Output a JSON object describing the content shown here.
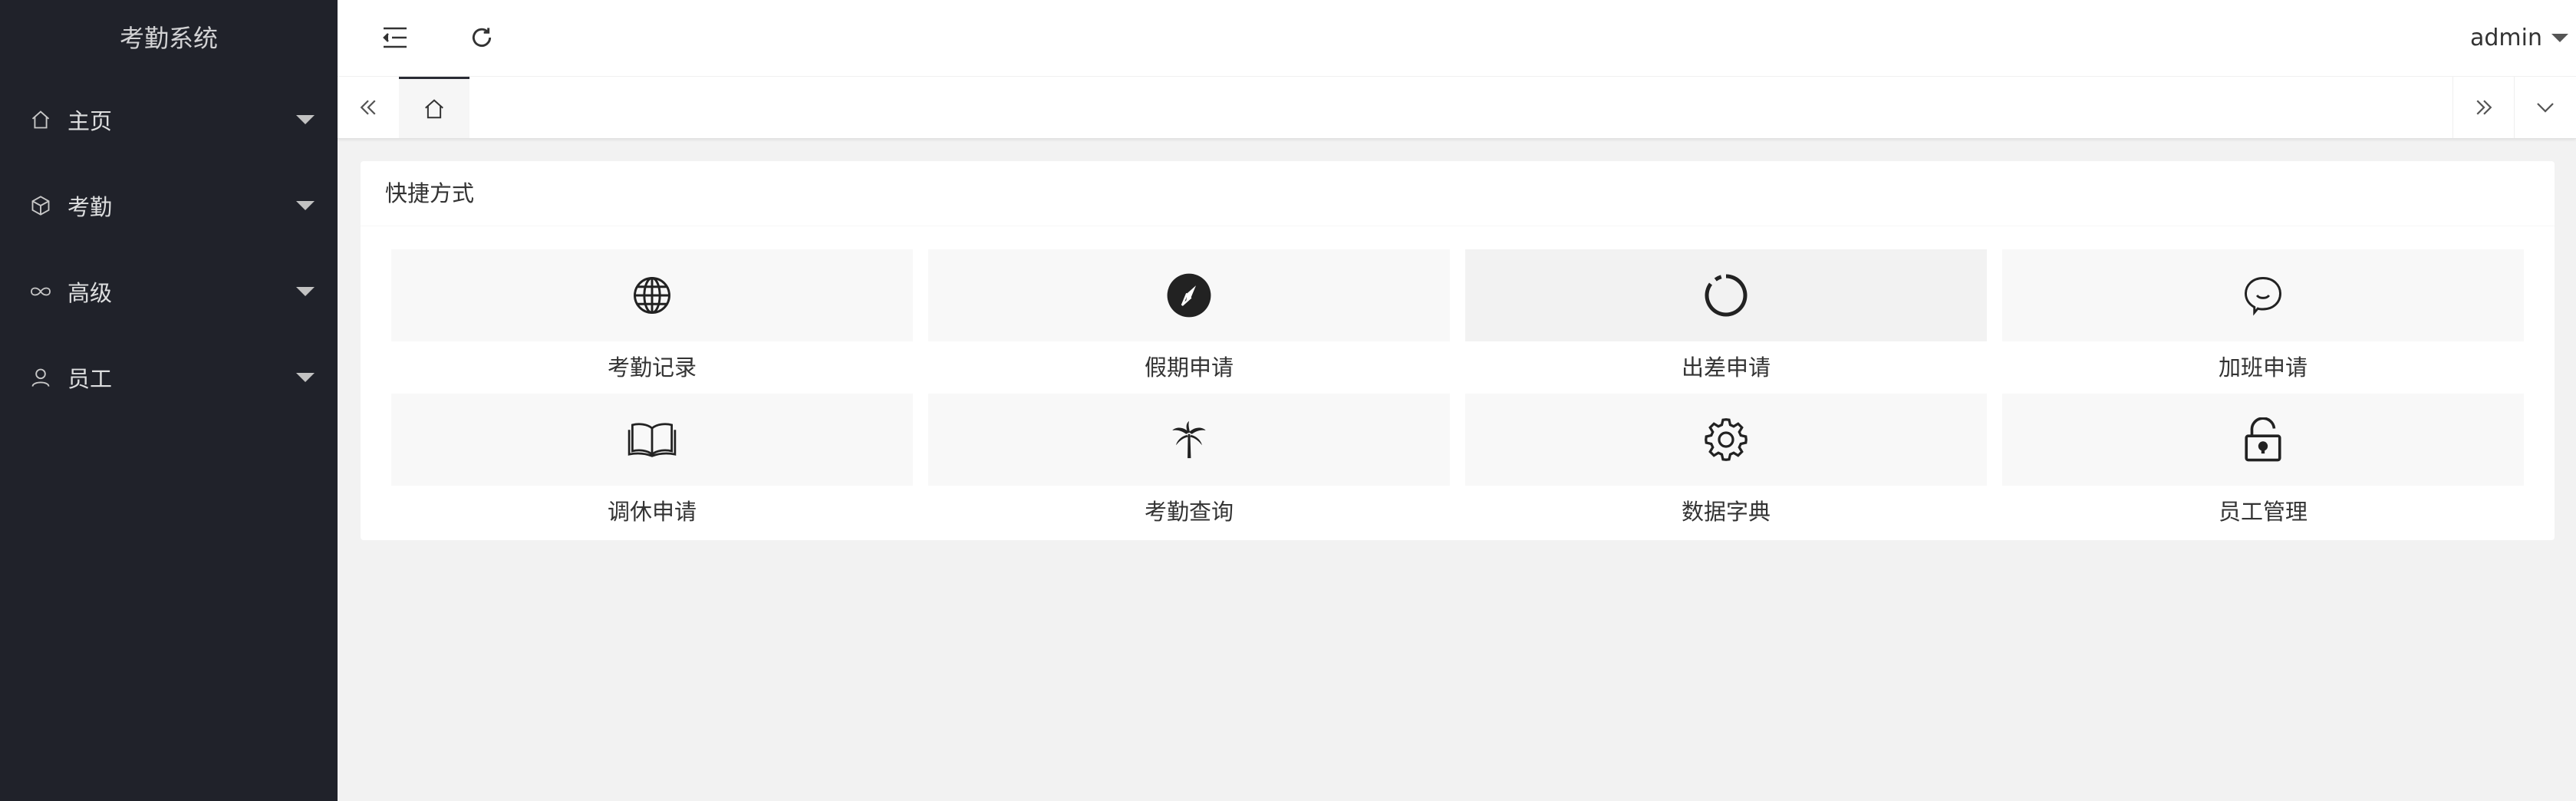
{
  "app": {
    "title": "考勤系统"
  },
  "sidebar": {
    "items": [
      {
        "label": "主页",
        "icon": "home-icon"
      },
      {
        "label": "考勤",
        "icon": "cube-icon"
      },
      {
        "label": "高级",
        "icon": "infinity-icon"
      },
      {
        "label": "员工",
        "icon": "user-icon"
      }
    ]
  },
  "header": {
    "user": "admin"
  },
  "tabs": {
    "home_icon": "home-icon"
  },
  "shortcuts": {
    "title": "快捷方式",
    "items": [
      {
        "label": "考勤记录",
        "icon": "globe-icon"
      },
      {
        "label": "假期申请",
        "icon": "compass-icon"
      },
      {
        "label": "出差申请",
        "icon": "loading-ring-icon"
      },
      {
        "label": "加班申请",
        "icon": "chat-bubble-icon"
      },
      {
        "label": "调休申请",
        "icon": "open-book-icon"
      },
      {
        "label": "考勤查询",
        "icon": "palm-tree-icon"
      },
      {
        "label": "数据字典",
        "icon": "gear-icon"
      },
      {
        "label": "员工管理",
        "icon": "unlock-icon"
      }
    ]
  },
  "colors": {
    "sidebar_bg": "#20222a",
    "page_bg": "#f2f2f2",
    "tile_bg": "#f8f8f8",
    "text": "#333333"
  }
}
